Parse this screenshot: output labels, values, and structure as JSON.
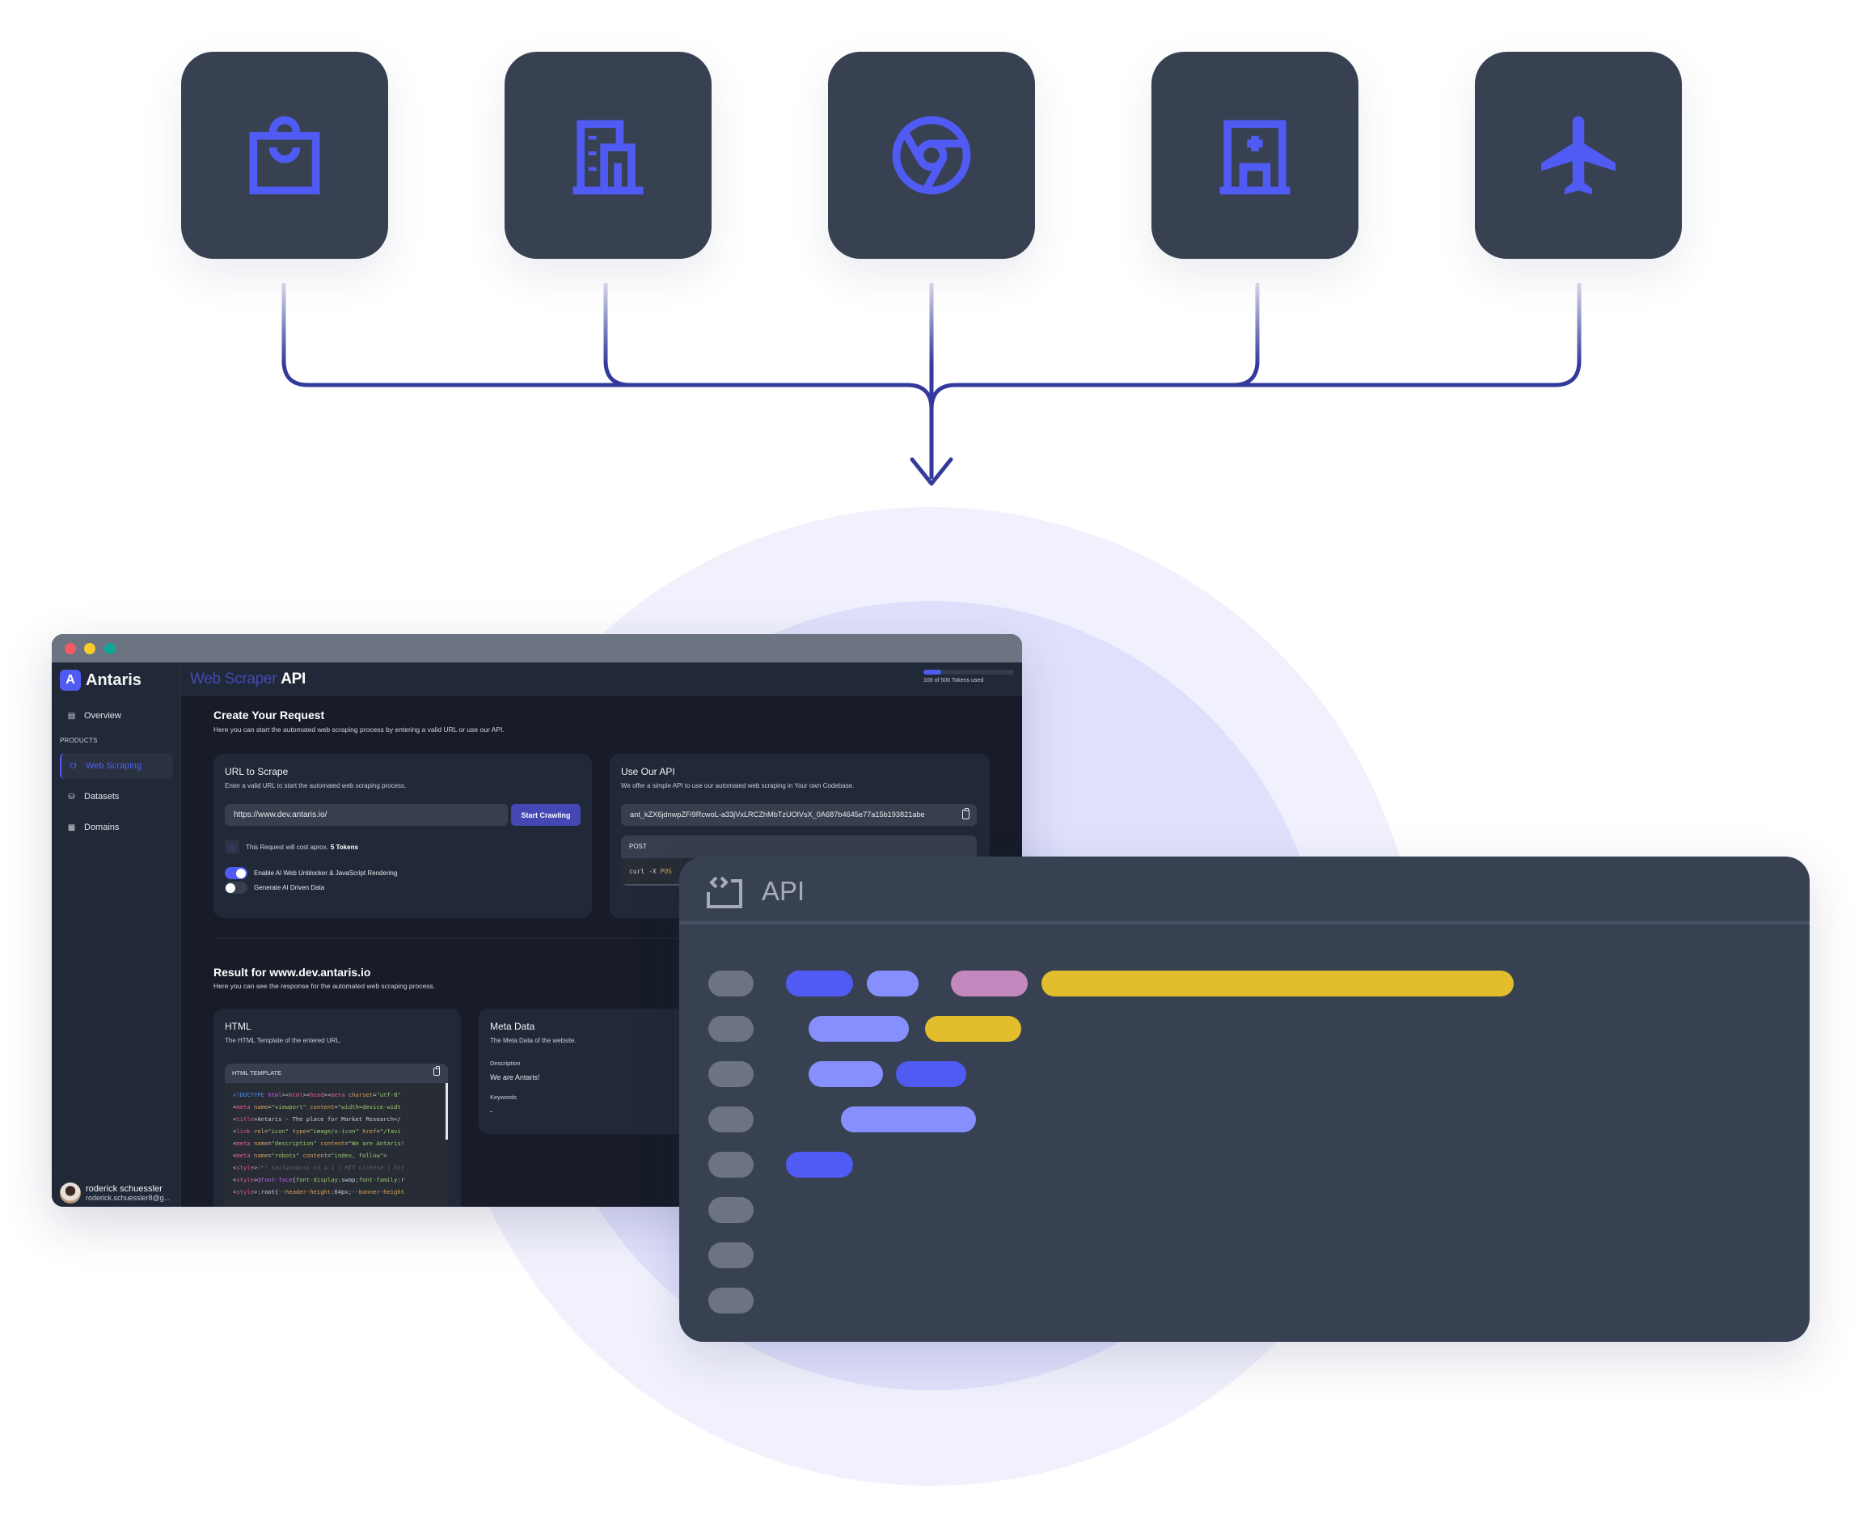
{
  "colors": {
    "tile_bg": "#384152",
    "icon_accent": "#4F5BF2",
    "connector": "#343A9B",
    "circle_outer": "#F1F1FD",
    "circle_inner": "#DFE1FC",
    "bar_blue": "#4F5BF2",
    "bar_light": "#858FFD",
    "bar_pink": "#C388BE",
    "bar_yellow": "#E2BD2C",
    "gutter": "#6C7381"
  },
  "sources": [
    {
      "name": "shopping",
      "icon": "shopping-bag-icon"
    },
    {
      "name": "business",
      "icon": "office-building-icon"
    },
    {
      "name": "web",
      "icon": "chrome-browser-icon"
    },
    {
      "name": "healthcare",
      "icon": "hospital-icon"
    },
    {
      "name": "travel",
      "icon": "airplane-icon"
    }
  ],
  "app": {
    "logo": "Antaris",
    "logo_mark": "A",
    "header_accent": "Web Scraper",
    "header_plain": "API",
    "tokens": {
      "used": 100,
      "total": 500,
      "label": "100 of 500 Tokens used"
    },
    "sidebar": {
      "items": [
        {
          "label": "Overview",
          "icon": "layout-icon"
        },
        {
          "label": "Web Scraping",
          "icon": "spider-icon",
          "active": true
        },
        {
          "label": "Datasets",
          "icon": "database-icon"
        },
        {
          "label": "Domains",
          "icon": "table-icon"
        }
      ],
      "section_label": "PRODUCTS"
    },
    "user": {
      "name": "roderick schuessler",
      "email": "roderick.schuessler8@g..."
    },
    "create": {
      "title": "Create Your Request",
      "description": "Here you can start the automated web scraping process by entering a valid URL or use our API."
    },
    "url_card": {
      "title": "URL to Scrape",
      "subtitle": "Enter a valid URL to start the automated web scraping process.",
      "url_value": "https://www.dev.antaris.io/",
      "button": "Start Crawling",
      "cost_text": "This Request will cost aprox.",
      "cost_value": "5 Tokens",
      "toggle1": {
        "label": "Enable AI Web Unblocker & JavaScript Rendering",
        "on": true
      },
      "toggle2": {
        "label": "Generate AI Driven Data",
        "on": false
      }
    },
    "api_card": {
      "title": "Use Our API",
      "subtitle": "We offer a simple API to use our automated web scraping in Your own Codebase.",
      "api_key": "ant_kZX6jdnwpZFi9RcwoL-a33jVxLRCZhMbTzUOlVsX_0A687b4645e77a15b193821abe",
      "method": "POST",
      "code_cmd": "curl -X",
      "code_kw": "POS"
    },
    "result": {
      "title": "Result for www.dev.antaris.io",
      "description": "Here you can see the response for the automated web scraping process."
    },
    "html_card": {
      "title": "HTML",
      "subtitle": "The HTML Template of the entered URL.",
      "box_label": "HTML TEMPLATE"
    },
    "meta_card": {
      "title": "Meta Data",
      "subtitle": "The Meta Data of the website.",
      "description_label": "Description",
      "description_value": "We are Antaris!",
      "keywords_label": "Keywords",
      "keywords_value": "-"
    }
  },
  "api_panel": {
    "title": "API",
    "icon": "code-window-icon",
    "gutter_rows": 8,
    "rows": [
      [
        {
          "color": "blue",
          "start": 0,
          "len": 83
        },
        {
          "color": "light",
          "start": 100,
          "len": 64
        },
        {
          "color": "pink",
          "start": 204,
          "len": 95
        },
        {
          "color": "yellow",
          "start": 316,
          "len": 584
        }
      ],
      [
        {
          "color": "light",
          "start": 28,
          "len": 124
        },
        {
          "color": "yellow",
          "start": 172,
          "len": 119
        }
      ],
      [
        {
          "color": "light",
          "start": 28,
          "len": 92
        },
        {
          "color": "blue",
          "start": 136,
          "len": 87
        }
      ],
      [
        {
          "color": "light",
          "start": 68,
          "len": 167
        }
      ],
      [
        {
          "color": "blue",
          "start": 0,
          "len": 83
        }
      ]
    ]
  }
}
